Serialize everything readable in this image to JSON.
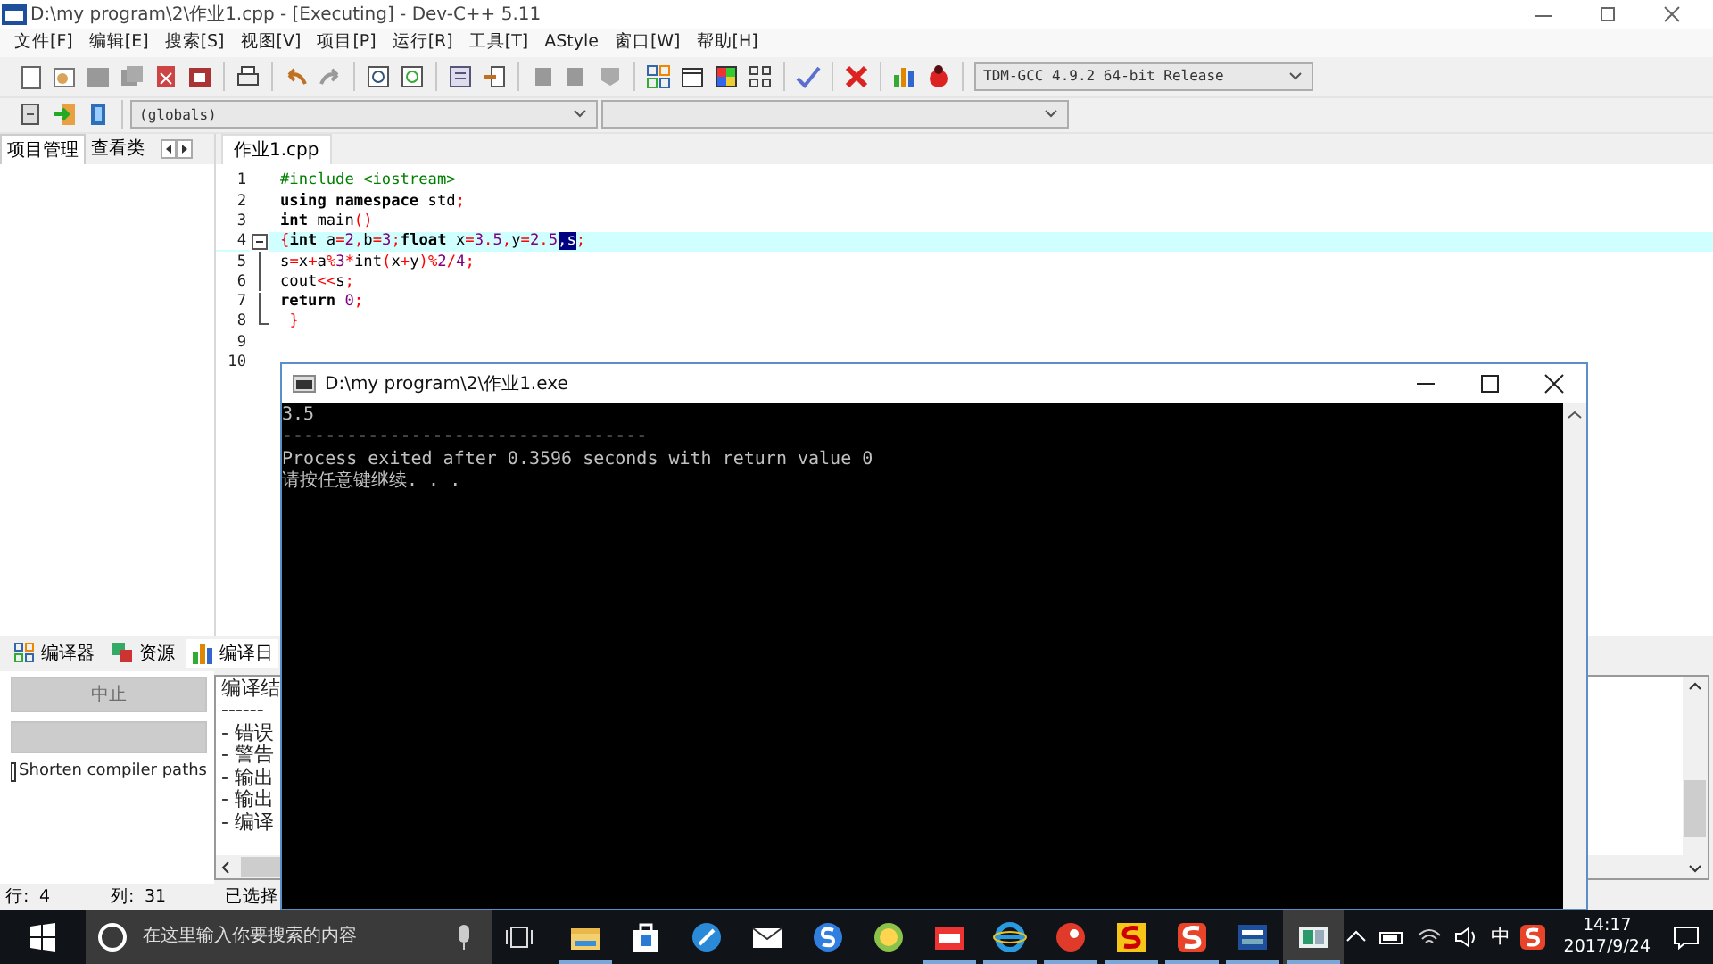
{
  "window": {
    "title": "D:\\my program\\2\\作业1.cpp - [Executing] - Dev-C++ 5.11"
  },
  "menu": [
    "文件[F]",
    "编辑[E]",
    "搜索[S]",
    "视图[V]",
    "项目[P]",
    "运行[R]",
    "工具[T]",
    "AStyle",
    "窗口[W]",
    "帮助[H]"
  ],
  "toolbar": {
    "compiler": "TDM-GCC 4.9.2 64-bit Release"
  },
  "toolbar2": {
    "scope": "(globals)"
  },
  "left_panel": {
    "tabs": [
      {
        "label": "项目管理",
        "selected": true
      },
      {
        "label": "查看类",
        "selected": false
      }
    ]
  },
  "editor": {
    "tabs": [
      {
        "label": "作业1.cpp",
        "selected": true
      }
    ],
    "lines": [
      {
        "number": "1",
        "code": "#include <iostream>",
        "current": false
      },
      {
        "number": "2",
        "code": "**using namespace** std;",
        "current": false
      },
      {
        "number": "3",
        "code": "**int** main()",
        "current": false
      },
      {
        "number": "4",
        "code": "{**int** a=2,b=3;**float** x=3.5,y=2.5",
        "selected_code": ",s",
        "code_after": ";",
        "current": true,
        "expanded": true
      },
      {
        "number": "5",
        "code": "s=x+a%3*int(x+y)%2/4;",
        "current": false
      },
      {
        "number": "6",
        "code": "cout<<s;",
        "current": false
      },
      {
        "number": "7",
        "code": "**return** 0;",
        "current": false
      },
      {
        "number": "8",
        "code": " }",
        "current": false,
        "fold_end": true
      },
      {
        "number": "9",
        "current": false
      },
      {
        "number": "10",
        "current": false
      }
    ]
  },
  "bottom_panel": {
    "tabs": [
      {
        "label": "编译器",
        "kind": "grid",
        "selected": false
      },
      {
        "label": "资源",
        "kind": "resources",
        "selected": false
      },
      {
        "label": "编译日",
        "kind": "chart",
        "selected": true
      }
    ],
    "abort_button": {
      "label": "中止",
      "disabled": true
    },
    "shorten_paths": {
      "label": "Shorten compiler paths",
      "checked": false
    },
    "log": [
      "编译结",
      "------",
      "- 错误",
      "- 警告",
      "- 输出",
      "- 输出",
      "- 编译"
    ]
  },
  "status_bar": {
    "line_label": "行:",
    "line": "4",
    "col_label": "列:",
    "col": "31",
    "selection_label": "已选择"
  },
  "console": {
    "title": "D:\\my program\\2\\作业1.exe",
    "output": [
      "3.5",
      "----------------------------------",
      "Process exited after 0.3596 seconds with return value 0",
      "请按任意键继续. . ."
    ]
  },
  "taskbar": {
    "search": {
      "placeholder": "在这里输入你要搜索的内容"
    },
    "apps": [
      {
        "kind": "folder",
        "running": true,
        "selected": false
      },
      {
        "kind": "store",
        "running": false,
        "selected": false
      },
      {
        "kind": "compass",
        "running": false,
        "selected": false
      },
      {
        "kind": "mail",
        "running": false,
        "selected": false
      },
      {
        "kind": "blue-s",
        "running": false,
        "selected": false
      },
      {
        "kind": "ball",
        "running": false,
        "selected": false
      },
      {
        "kind": "mall",
        "running": true,
        "selected": false
      },
      {
        "kind": "ie",
        "running": true,
        "selected": false
      },
      {
        "kind": "bird",
        "running": true,
        "selected": false
      },
      {
        "kind": "yellow-s",
        "running": true,
        "selected": false
      },
      {
        "kind": "red-s",
        "running": true,
        "selected": false
      },
      {
        "kind": "dev",
        "running": true,
        "selected": false
      },
      {
        "kind": "window",
        "running": true,
        "selected": true
      }
    ],
    "ime": "中",
    "time": "14:17",
    "date": "2017/9/24"
  }
}
